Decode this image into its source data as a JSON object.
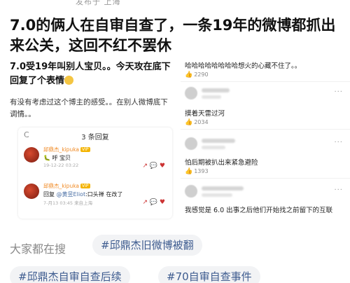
{
  "top_partial": "发布于 上海",
  "headline": "7.0的俩人在自审自查了，一条19年的微博都抓出来公关，这回不红不罢休",
  "left": {
    "title": "7.0受19年叫别人宝贝。。今天攻在底下回复了个表情",
    "body": "有没有考虑过这个博主的感受。。在别人微博底下调情。。",
    "reply_header": "3 条回复",
    "replies": [
      {
        "name": "邱鼎杰_kipuka",
        "badge": "VIP",
        "text": "🐛 呼 宝贝",
        "meta": "19-12-22 03:22",
        "actions": "↗ 💬 ♥"
      },
      {
        "name": "邱鼎杰_kipuka",
        "badge": "VIP",
        "text_prefix": "回复 ",
        "mention": "@黄昱Eliot",
        "text_suffix": ":口头禅 在改了",
        "meta": "7-月13 03:45 来自上海",
        "actions": "↗ 💬 ♥"
      }
    ]
  },
  "right": {
    "c1_text": "哈哈哈哈哈哈哈哈想火的心藏不住了。。",
    "c1_likes": "2290",
    "c2_text": "摸着天雷过河",
    "c2_likes": "2034",
    "c3_text": "怕后期被扒出来紧急避险",
    "c3_likes": "1393",
    "c4_text": "我感觉是 6.0 出事之后他们开始找之前留下的互联",
    "more": "···"
  },
  "search": {
    "label": "大家都在搜",
    "tags": [
      "#邱鼎杰旧微博被翻",
      "#邱鼎杰自审自查后续",
      "#70自审自查事件"
    ]
  }
}
